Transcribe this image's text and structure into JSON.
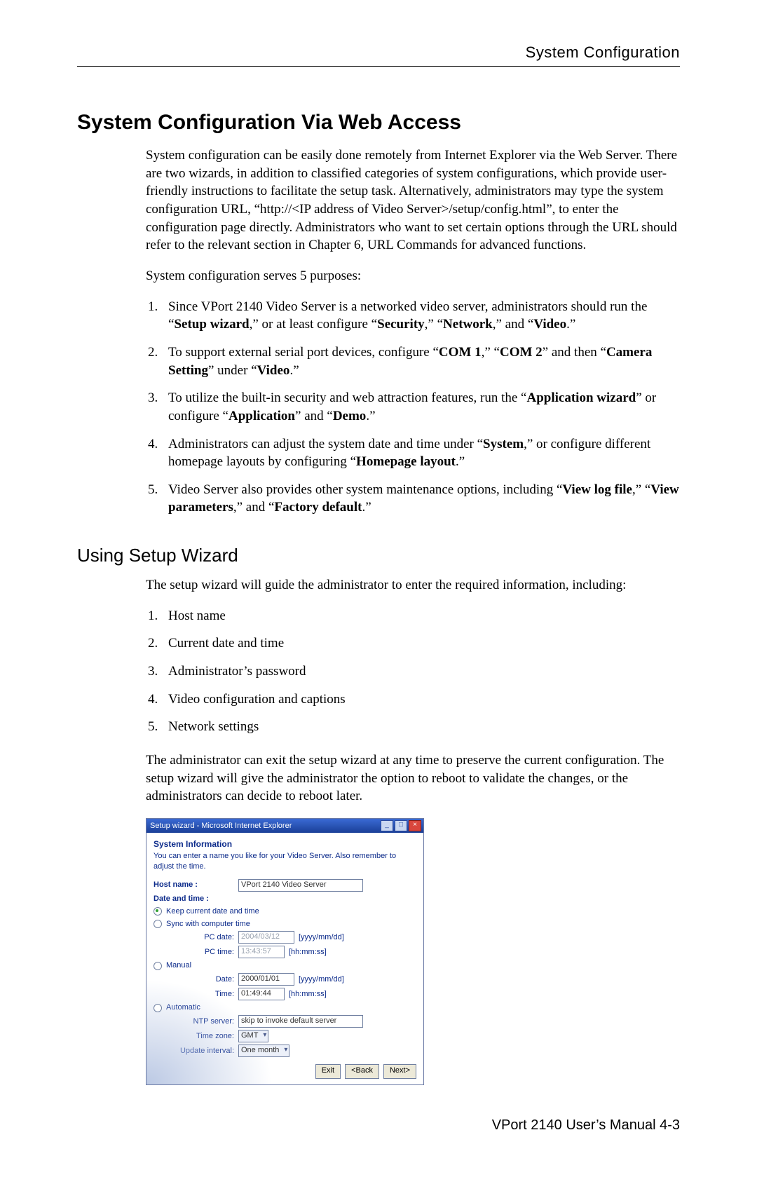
{
  "header": {
    "title": "System Configuration"
  },
  "section": {
    "title": "System Configuration Via Web Access",
    "intro": "System configuration can be easily done remotely from Internet Explorer via the Web Server. There are two wizards, in addition to classified categories of system configurations, which provide user-friendly instructions to facilitate the setup task. Alternatively, administrators may type the system configuration URL, “http://<IP address of Video Server>/setup/config.html”, to enter the configuration page directly. Administrators who want to set certain options through the URL should refer to the relevant section in Chapter 6, URL Commands for advanced functions.",
    "purposes_lead": "System configuration serves 5 purposes:",
    "purposes": [
      {
        "pre": "Since VPort 2140 Video Server is a networked video server, administrators should run the “",
        "b1": "Setup wizard",
        "mid1": ",” or at least configure “",
        "b2": "Security",
        "mid2": ",” “",
        "b3": "Network",
        "mid3": ",” and “",
        "b4": "Video",
        "post": ".”"
      },
      {
        "pre": "To support external serial port devices, configure “",
        "b1": "COM 1",
        "mid1": ",” “",
        "b2": "COM 2",
        "mid2": "” and then “",
        "b3": "Camera Setting",
        "mid3": "” under “",
        "b4": "Video",
        "post": ".”"
      },
      {
        "pre": "To utilize the built-in security and web attraction features, run the “",
        "b1": "Application wizard",
        "mid1": "” or configure “",
        "b2": "Application",
        "mid2": "” and “",
        "b3": "Demo",
        "mid3": "",
        "b4": "",
        "post": ".”"
      },
      {
        "pre": "Administrators can adjust the system date and time under “",
        "b1": "System",
        "mid1": ",” or configure different homepage layouts by configuring “",
        "b2": "Homepage layout",
        "mid2": "",
        "b3": "",
        "mid3": "",
        "b4": "",
        "post": ".”"
      },
      {
        "pre": "Video Server also provides other system maintenance options, including “",
        "b1": "View log file",
        "mid1": ",” “",
        "b2": "View parameters",
        "mid2": ",” and “",
        "b3": "Factory default",
        "mid3": "",
        "b4": "",
        "post": ".”"
      }
    ]
  },
  "subsection": {
    "title": "Using Setup Wizard",
    "lead": "The setup wizard will guide the administrator to enter the required information, including:",
    "items": [
      "Host name",
      "Current date and time",
      "Administrator’s password",
      "Video configuration and captions",
      "Network settings"
    ],
    "paragraph": "The administrator can exit the setup wizard at any time to preserve the current configuration. The setup wizard will give the administrator the option to reboot to validate the changes, or the administrators can decide to reboot later."
  },
  "dialog": {
    "window_title": "Setup wizard - Microsoft Internet Explorer",
    "heading": "System Information",
    "sub": "You can enter a name you like for your Video Server. Also remember to adjust the time.",
    "hostname_label": "Host name :",
    "hostname_value": "VPort 2140 Video Server",
    "dt_label": "Date and time :",
    "opt_keep": "Keep current date and time",
    "opt_sync": "Sync with computer time",
    "pc_date_label": "PC date:",
    "pc_date_value": "2004/03/12",
    "pc_date_hint": "[yyyy/mm/dd]",
    "pc_time_label": "PC time:",
    "pc_time_value": "13:43:57",
    "pc_time_hint": "[hh:mm:ss]",
    "opt_manual": "Manual",
    "m_date_label": "Date:",
    "m_date_value": "2000/01/01",
    "m_date_hint": "[yyyy/mm/dd]",
    "m_time_label": "Time:",
    "m_time_value": "01:49:44",
    "m_time_hint": "[hh:mm:ss]",
    "opt_auto": "Automatic",
    "ntp_label": "NTP server:",
    "ntp_value": "skip to invoke default server",
    "tz_label": "Time zone:",
    "tz_value": "GMT",
    "upd_label": "Update interval:",
    "upd_value": "One month",
    "btn_exit": "Exit",
    "btn_back": "<Back",
    "btn_next": "Next>"
  },
  "footer": {
    "text": "VPort 2140 User’s Manual   4-3"
  }
}
